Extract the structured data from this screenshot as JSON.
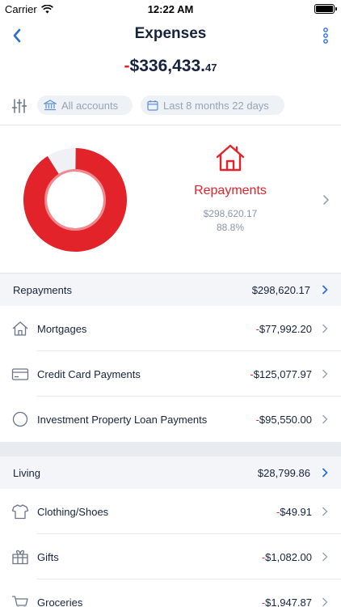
{
  "status_bar": {
    "carrier": "Carrier",
    "time": "12:22 AM"
  },
  "nav": {
    "title": "Expenses",
    "back_icon": "chevron-left-icon",
    "more_icon": "more-vertical-icon"
  },
  "total": {
    "sign": "-",
    "whole": "$336,433.",
    "cents": "47"
  },
  "filters": {
    "accounts_label": "All accounts",
    "dates_label": "Last 8 months 22 days"
  },
  "chart_data": {
    "type": "pie",
    "style": "donut",
    "slices": [
      {
        "label": "Repayments",
        "value": 298620.17,
        "percent": 88.8,
        "color": "#e2232a"
      },
      {
        "label": "Living",
        "value": 28799.86,
        "percent": 8.6,
        "color": "#eff1f4"
      }
    ]
  },
  "featured": {
    "icon": "house-icon",
    "title": "Repayments",
    "amount": "$298,620.17",
    "percent": "88.8%"
  },
  "sections": [
    {
      "label": "Repayments",
      "amount": "$298,620.17",
      "items": [
        {
          "icon": "house-icon",
          "label": "Mortgages",
          "sign": "-",
          "amount": "$77,992.20"
        },
        {
          "icon": "credit-card-icon",
          "label": "Credit Card Payments",
          "sign": "-",
          "amount": "$125,077.97"
        },
        {
          "icon": "circle-icon",
          "label": "Investment Property Loan Payments",
          "sign": "-",
          "amount": "$95,550.00"
        }
      ]
    },
    {
      "label": "Living",
      "amount": "$28,799.86",
      "items": [
        {
          "icon": "shirt-icon",
          "label": "Clothing/Shoes",
          "sign": "-",
          "amount": "$49.91"
        },
        {
          "icon": "gift-icon",
          "label": "Gifts",
          "sign": "-",
          "amount": "$1,082.00"
        },
        {
          "icon": "shopping-cart-icon",
          "label": "Groceries",
          "sign": "-",
          "amount": "$1,947.87"
        }
      ]
    }
  ],
  "colors": {
    "accent_red": "#e2232a",
    "link_blue": "#2b6fd0",
    "text_dark": "#17233d",
    "muted": "#8b95a5"
  }
}
